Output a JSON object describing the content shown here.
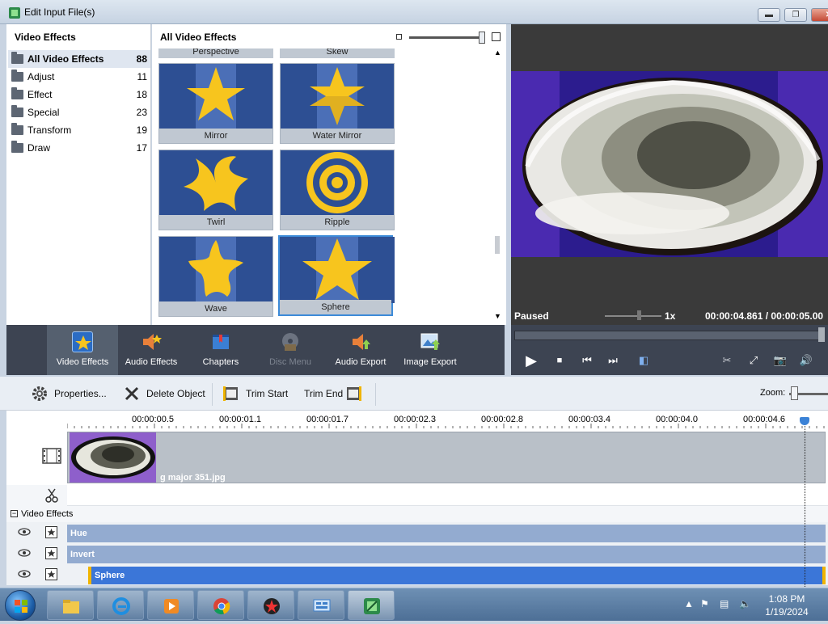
{
  "window": {
    "title": "Edit Input File(s)",
    "min": "▬",
    "max": "❐",
    "close": "✕"
  },
  "categories": {
    "header": "Video Effects",
    "items": [
      {
        "label": "All Video Effects",
        "count": "88"
      },
      {
        "label": "Adjust",
        "count": "11"
      },
      {
        "label": "Effect",
        "count": "18"
      },
      {
        "label": "Special",
        "count": "23"
      },
      {
        "label": "Transform",
        "count": "19"
      },
      {
        "label": "Draw",
        "count": "17"
      }
    ]
  },
  "gallery": {
    "header": "All Video Effects",
    "partial_top": [
      "Perspective",
      "Skew"
    ],
    "effects": [
      "Mirror",
      "Water Mirror",
      "Twirl",
      "Ripple",
      "Wave",
      "Sphere"
    ],
    "selected": "Sphere"
  },
  "preview": {
    "status": "Paused",
    "speed": "1x",
    "time": "00:00:04.861 / 00:00:05.00"
  },
  "toolbar": {
    "video_effects": "Video Effects",
    "audio_effects": "Audio Effects",
    "chapters": "Chapters",
    "disc_menu": "Disc Menu",
    "audio_export": "Audio Export",
    "image_export": "Image Export"
  },
  "player": {
    "play": "▶",
    "stop": "■",
    "prev": "⏮",
    "next": "⏭",
    "cut": "✂",
    "fullscreen": "⤢",
    "snapshot": "📷",
    "volume": "🔊",
    "progress": 0.97
  },
  "edit": {
    "properties": "Properties...",
    "delete_object": "Delete Object",
    "trim_start": "Trim Start",
    "trim_end": "Trim End",
    "zoom_label": "Zoom:"
  },
  "timeline": {
    "ticks": [
      "00:00:00.5",
      "00:00:01.1",
      "00:00:01.7",
      "00:00:02.3",
      "00:00:02.8",
      "00:00:03.4",
      "00:00:04.0",
      "00:00:04.6"
    ],
    "clip_name": "g major 351.jpg",
    "fx_section": "Video Effects",
    "fx_toggle": "−",
    "effects": [
      "Hue",
      "Invert",
      "Sphere"
    ]
  },
  "taskbar": {
    "time": "1:08 PM",
    "date": "1/19/2024"
  },
  "colors": {
    "accent": "#3b76d8",
    "toolbar_bg": "#3d4452",
    "fx_bar": "#93abd0"
  }
}
